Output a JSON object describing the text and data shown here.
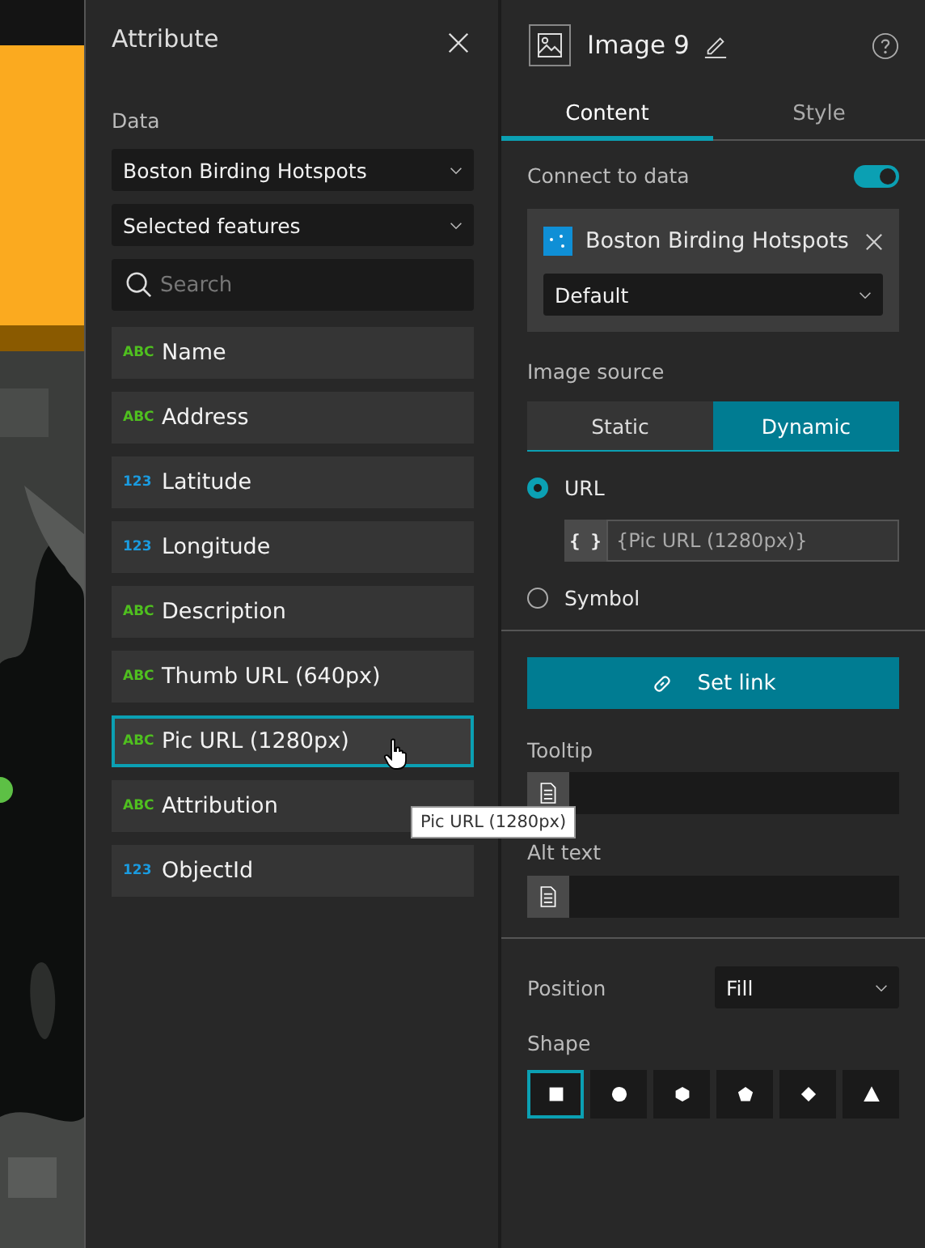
{
  "attribute_panel": {
    "title": "Attribute",
    "data_label": "Data",
    "data_source": "Boston Birding Hotspots",
    "feature_filter": "Selected features",
    "search": {
      "placeholder": "Search"
    },
    "fields": [
      {
        "kind": "string",
        "type": "ABC",
        "name": "Name",
        "selected": false
      },
      {
        "kind": "string",
        "type": "ABC",
        "name": "Address",
        "selected": false
      },
      {
        "kind": "number",
        "type": "123",
        "name": "Latitude",
        "selected": false
      },
      {
        "kind": "number",
        "type": "123",
        "name": "Longitude",
        "selected": false
      },
      {
        "kind": "string",
        "type": "ABC",
        "name": "Description",
        "selected": false
      },
      {
        "kind": "string",
        "type": "ABC",
        "name": "Thumb URL (640px)",
        "selected": false
      },
      {
        "kind": "string",
        "type": "ABC",
        "name": "Pic URL (1280px)",
        "selected": true
      },
      {
        "kind": "string",
        "type": "ABC",
        "name": "Attribution",
        "selected": false
      },
      {
        "kind": "number",
        "type": "123",
        "name": "ObjectId",
        "selected": false
      }
    ]
  },
  "hover_tooltip": "Pic URL (1280px)",
  "settings": {
    "title": "Image 9",
    "tabs": [
      {
        "label": "Content",
        "selected": true
      },
      {
        "label": "Style",
        "selected": false
      }
    ],
    "connect_to_data": {
      "label": "Connect to data",
      "on": true
    },
    "data_source": {
      "name": "Boston Birding Hotspots",
      "view": "Default"
    },
    "image_source": {
      "label": "Image source",
      "modes": [
        {
          "label": "Static",
          "selected": false
        },
        {
          "label": "Dynamic",
          "selected": true
        }
      ],
      "options": [
        {
          "label": "URL",
          "selected": true
        },
        {
          "label": "Symbol",
          "selected": false
        }
      ],
      "expression_button": "{ }",
      "expression": "{Pic URL (1280px)}"
    },
    "set_link": "Set link",
    "tooltip": {
      "label": "Tooltip"
    },
    "alt_text": {
      "label": "Alt text"
    },
    "position": {
      "label": "Position",
      "value": "Fill"
    },
    "shape": {
      "label": "Shape",
      "options": [
        {
          "kind": "square",
          "selected": true
        },
        {
          "kind": "circle",
          "selected": false
        },
        {
          "kind": "hexagon",
          "selected": false
        },
        {
          "kind": "pentagon",
          "selected": false
        },
        {
          "kind": "diamond",
          "selected": false
        },
        {
          "kind": "triangle",
          "selected": false
        }
      ]
    }
  }
}
